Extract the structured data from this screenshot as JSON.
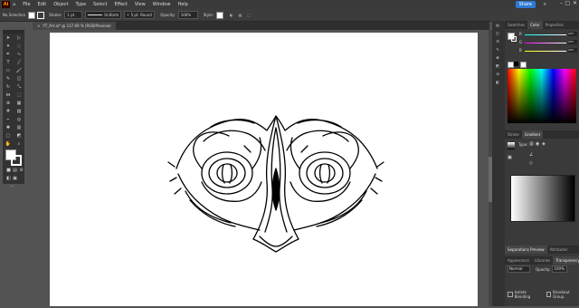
{
  "menubar": {
    "app_icon": "Ai",
    "items": [
      "File",
      "Edit",
      "Object",
      "Type",
      "Select",
      "Effect",
      "View",
      "Window",
      "Help"
    ],
    "share_label": "Share"
  },
  "control": {
    "selection": "No Selection",
    "stroke_label": "Stroke:",
    "stroke_value": "1 pt",
    "brush_label": "Uniform",
    "profile_label": "5 pt. Round",
    "opacity_label": "Opacity:",
    "opacity_value": "100%",
    "style_label": "Style:"
  },
  "document": {
    "tab_label": "YT_Art.ai* @ 117.69 % (RGB/Preview)"
  },
  "panels": {
    "color_tabs": [
      "Swatches",
      "Color",
      "Properties"
    ],
    "color_channels": [
      "R",
      "G",
      "B"
    ],
    "color_values": [
      "255",
      "255",
      "255"
    ],
    "gradient_tabs": [
      "Stroke",
      "Gradient"
    ],
    "gradient_type_label": "Type:",
    "bottom_tabs_1": [
      "Separations Preview",
      "Attributes"
    ],
    "bottom_tabs_2": [
      "Appearance",
      "Libraries",
      "Transparency"
    ],
    "blend_mode": "Normal",
    "opacity_label": "Opacity:",
    "opacity_value": "100%",
    "isolate_label": "Isolate Blending",
    "knockout_label": "Knockout Group"
  },
  "colors": {
    "menubar": "#3a3a3a",
    "share": "#2d7ad4",
    "artboard": "#ffffff",
    "workspace": "#535353"
  }
}
